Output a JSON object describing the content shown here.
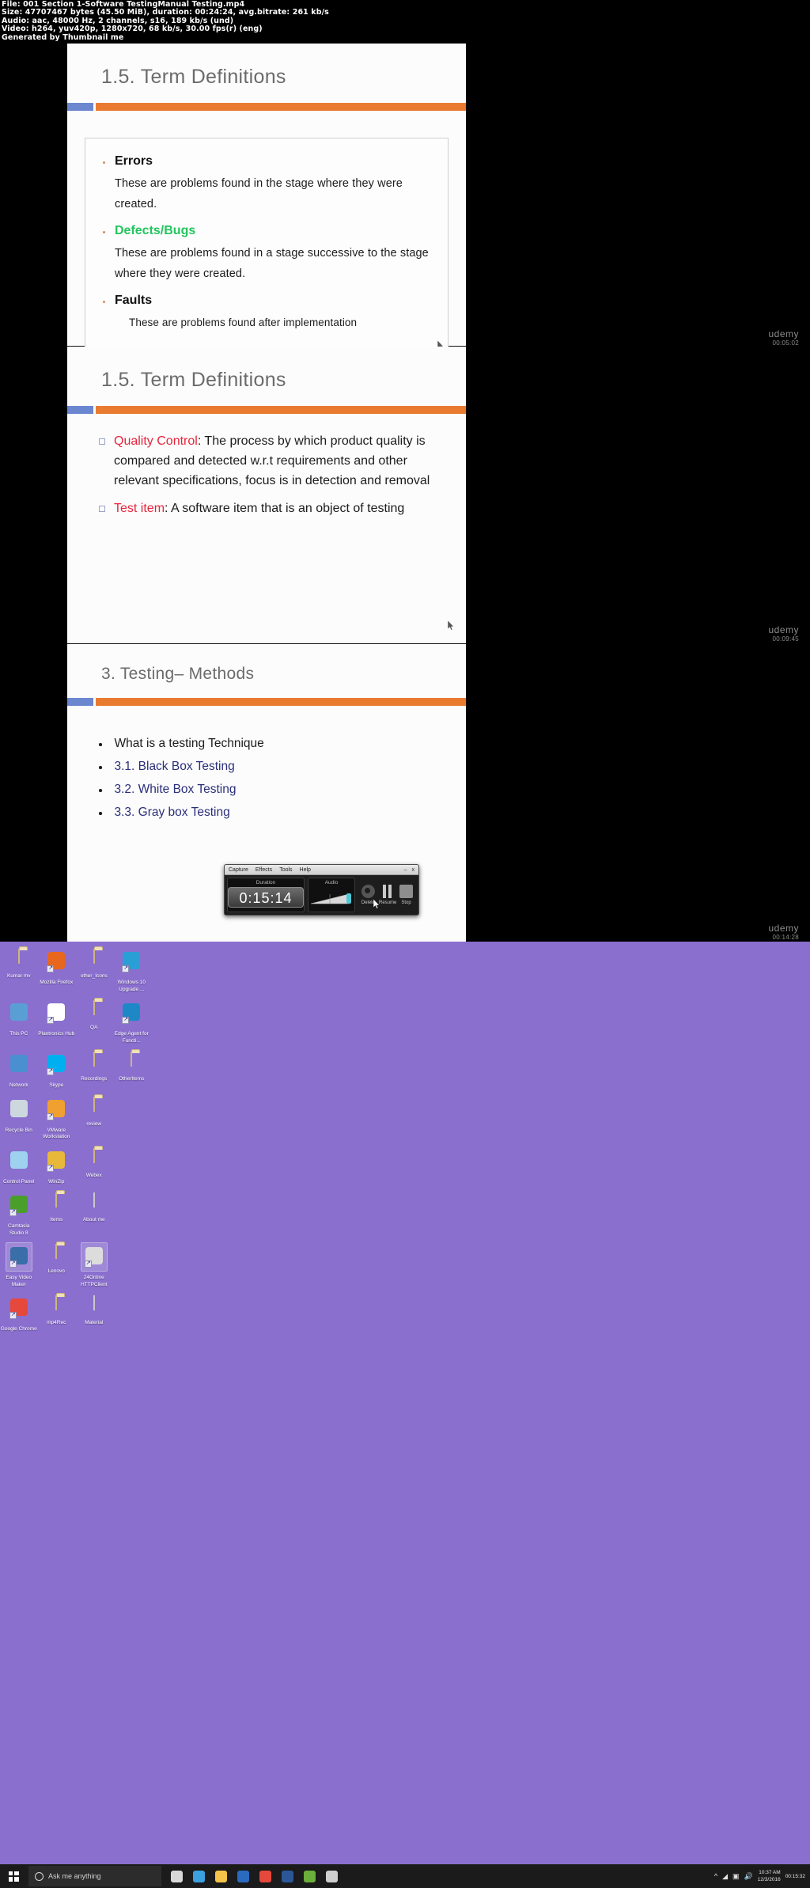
{
  "video_info": {
    "line_file": "File: 001 Section 1-Software TestingManual Testing.mp4",
    "line_size": "Size: 47707467 bytes (45.50 MiB), duration: 00:24:24, avg.bitrate: 261 kb/s",
    "line_audio": "Audio: aac, 48000 Hz, 2 channels, s16, 189 kb/s (und)",
    "line_video": "Video: h264, yuv420p, 1280x720, 68 kb/s, 30.00 fps(r) (eng)",
    "line_generator": "Generated by Thumbnail me"
  },
  "slides": [
    {
      "title": "1.5. Term Definitions",
      "items": [
        {
          "heading": "Errors",
          "heading_color": "#111111",
          "body": "These are problems found in the stage where they were created."
        },
        {
          "heading": "Defects/Bugs",
          "heading_color": "#22c55e",
          "body": "These are problems found in a stage successive to the stage where they were created."
        },
        {
          "heading": "Faults",
          "heading_color": "#111111",
          "body": "These are problems found after implementation"
        }
      ]
    },
    {
      "title": "1.5. Term Definitions",
      "bullets": [
        {
          "term": "Quality Control",
          "rest": ": The process by which product quality is compared and detected w.r.t requirements and other relevant specifications, focus is in detection and removal"
        },
        {
          "term": "Test item",
          "rest": ": A software item that is an object of testing"
        }
      ]
    },
    {
      "title": "3. Testing– Methods",
      "bullets": [
        {
          "text": "What is a testing Technique",
          "nav": false
        },
        {
          "text": "3.1. Black Box Testing",
          "nav": true
        },
        {
          "text": "3.2. White Box Testing",
          "nav": true
        },
        {
          "text": "3.3. Gray box Testing",
          "nav": true
        }
      ]
    }
  ],
  "watermarks": [
    {
      "brand": "udemy",
      "timestamp": "00:05:02"
    },
    {
      "brand": "udemy",
      "timestamp": "00:09:45"
    },
    {
      "brand": "udemy",
      "timestamp": "00:14:28"
    }
  ],
  "recorder": {
    "menu": [
      "Capture",
      "Effects",
      "Tools",
      "Help"
    ],
    "window_minimize": "–",
    "window_close": "x",
    "duration_label": "Duration",
    "duration_value": "0:15:14",
    "audio_label": "Audio",
    "controls": [
      {
        "name": "Delete",
        "icon": "delete-circle-icon"
      },
      {
        "name": "Resume",
        "icon": "pause-bars-icon"
      },
      {
        "name": "Stop",
        "icon": "stop-square-icon"
      }
    ]
  },
  "desktop": {
    "background_color": "#8a6fcf",
    "icons": [
      [
        {
          "label": "Kumar mv",
          "icon": "folder-user-icon",
          "shortcut": false,
          "selected": false
        },
        {
          "label": "Mozilla Firefox",
          "icon": "firefox-icon",
          "shortcut": true,
          "selected": false
        },
        {
          "label": "other_Icons",
          "icon": "folder-red-icon",
          "shortcut": false,
          "selected": false
        },
        {
          "label": "Windows 10 Upgrade ...",
          "icon": "windows-upgrade-icon",
          "shortcut": true,
          "selected": false
        }
      ],
      [
        {
          "label": "This PC",
          "icon": "this-pc-icon",
          "shortcut": false,
          "selected": false
        },
        {
          "label": "Plantronics Hub",
          "icon": "plantronics-icon",
          "shortcut": true,
          "selected": false
        },
        {
          "label": "QA",
          "icon": "folder-icon",
          "shortcut": false,
          "selected": false
        },
        {
          "label": "Edge Agent for Functi...",
          "icon": "edge-icon",
          "shortcut": true,
          "selected": false
        }
      ],
      [
        {
          "label": "Network",
          "icon": "network-globe-icon",
          "shortcut": false,
          "selected": false
        },
        {
          "label": "Skype",
          "icon": "skype-icon",
          "shortcut": true,
          "selected": false
        },
        {
          "label": "Recordings",
          "icon": "folder-icon",
          "shortcut": false,
          "selected": false
        },
        {
          "label": "OtherItems",
          "icon": "folder-icon",
          "shortcut": false,
          "selected": false
        }
      ],
      [
        {
          "label": "Recycle Bin",
          "icon": "recycle-bin-icon",
          "shortcut": false,
          "selected": false
        },
        {
          "label": "VMware Workstation",
          "icon": "vmware-icon",
          "shortcut": true,
          "selected": false
        },
        {
          "label": "review",
          "icon": "folder-icon",
          "shortcut": false,
          "selected": false
        },
        {
          "label": "",
          "icon": "",
          "shortcut": false,
          "selected": false
        }
      ],
      [
        {
          "label": "Control Panel",
          "icon": "control-panel-icon",
          "shortcut": false,
          "selected": false
        },
        {
          "label": "WinZip",
          "icon": "winzip-icon",
          "shortcut": true,
          "selected": false
        },
        {
          "label": "Webex",
          "icon": "folder-icon",
          "shortcut": false,
          "selected": false
        },
        {
          "label": "",
          "icon": "",
          "shortcut": false,
          "selected": false
        }
      ],
      [
        {
          "label": "Camtasia Studio 8",
          "icon": "camtasia-icon",
          "shortcut": true,
          "selected": false
        },
        {
          "label": "Items",
          "icon": "folder-icon",
          "shortcut": false,
          "selected": false
        },
        {
          "label": "About me",
          "icon": "about-me-icon",
          "shortcut": false,
          "selected": false
        },
        {
          "label": "",
          "icon": "",
          "shortcut": false,
          "selected": false
        }
      ],
      [
        {
          "label": "Easy Video Maker",
          "icon": "easy-video-maker-icon",
          "shortcut": true,
          "selected": true
        },
        {
          "label": "Lenovo",
          "icon": "folder-icon",
          "shortcut": false,
          "selected": false
        },
        {
          "label": "24Online HTTPClient",
          "icon": "http-client-icon",
          "shortcut": true,
          "selected": true
        },
        {
          "label": "",
          "icon": "",
          "shortcut": false,
          "selected": false
        }
      ],
      [
        {
          "label": "Google Chrome",
          "icon": "chrome-icon",
          "shortcut": true,
          "selected": false
        },
        {
          "label": "mp4Rec",
          "icon": "folder-icon",
          "shortcut": false,
          "selected": false
        },
        {
          "label": "Material",
          "icon": "document-icon",
          "shortcut": false,
          "selected": false
        },
        {
          "label": "",
          "icon": "",
          "shortcut": false,
          "selected": false
        }
      ]
    ]
  },
  "taskbar": {
    "start_icon": "windows-start-icon",
    "search_placeholder": "Ask me anything",
    "search_icon": "cortana-circle-icon",
    "pinned": [
      {
        "name": "task-view-icon",
        "color": "#d8d8d8"
      },
      {
        "name": "edge-icon",
        "color": "#3aa0e0"
      },
      {
        "name": "file-explorer-icon",
        "color": "#f5c349"
      },
      {
        "name": "outlook-icon",
        "color": "#2a6bbf"
      },
      {
        "name": "chrome-icon",
        "color": "#e6483c"
      },
      {
        "name": "word-icon",
        "color": "#2b5797"
      },
      {
        "name": "camtasia-icon",
        "color": "#6aae3c"
      },
      {
        "name": "media-icon",
        "color": "#cfcfcf"
      }
    ],
    "tray_icons": [
      "^",
      "wifi-icon",
      "volume-icon",
      "network-icon"
    ],
    "clock_time": "10:37 AM",
    "clock_date": "12/3/2016",
    "rec_time": "00:15:32"
  }
}
